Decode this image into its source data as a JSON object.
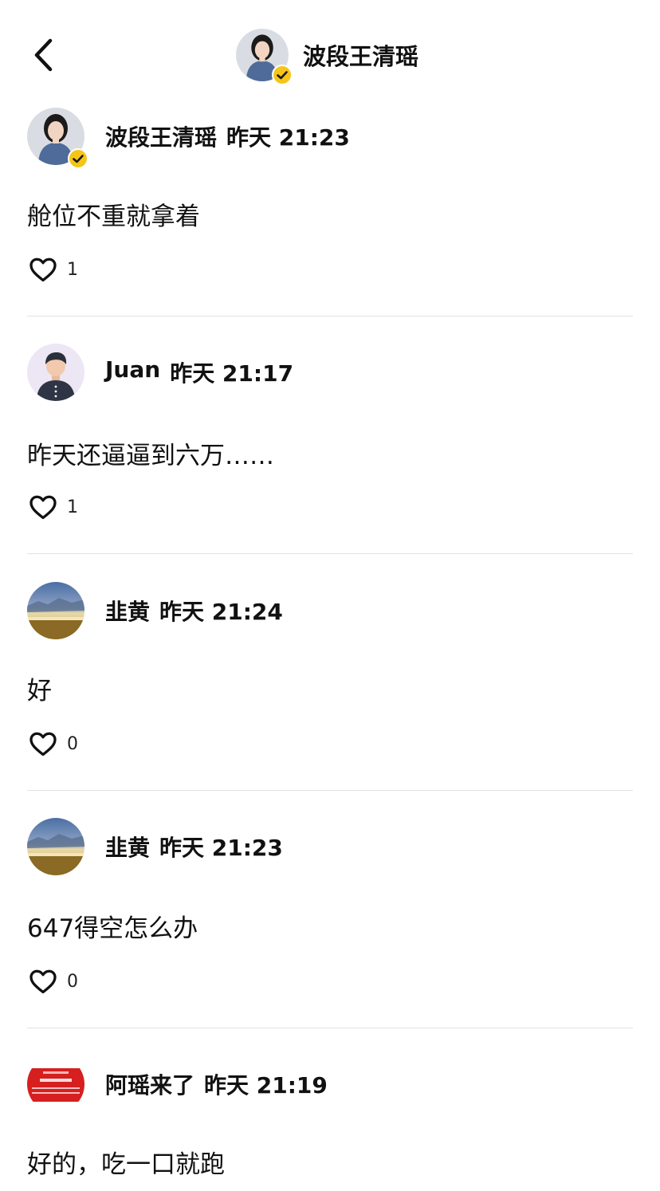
{
  "header": {
    "title": "波段王清瑶",
    "back_icon": "chevron-left-icon",
    "avatar_icon": "verified-user-avatar"
  },
  "colors": {
    "verified_badge": "#f5c518",
    "divider": "#e2e2e2",
    "text": "#111111"
  },
  "comments": [
    {
      "author": "波段王清瑶",
      "time": "昨天 21:23",
      "text": "舱位不重就拿着",
      "likes": "1",
      "avatar": "woman-verified",
      "verified": true
    },
    {
      "author": "Juan",
      "time": "昨天 21:17",
      "text": "昨天还逼逼到六万……",
      "likes": "1",
      "avatar": "default-person",
      "verified": false
    },
    {
      "author": "韭黄",
      "time": "昨天 21:24",
      "text": "好",
      "likes": "0",
      "avatar": "landscape",
      "verified": false
    },
    {
      "author": "韭黄",
      "time": "昨天 21:23",
      "text": "647得空怎么办",
      "likes": "0",
      "avatar": "landscape",
      "verified": false
    },
    {
      "author": "阿瑶来了",
      "time": "昨天 21:19",
      "text": "好的，吃一口就跑",
      "likes": "",
      "avatar": "red-banner",
      "verified": false
    }
  ]
}
